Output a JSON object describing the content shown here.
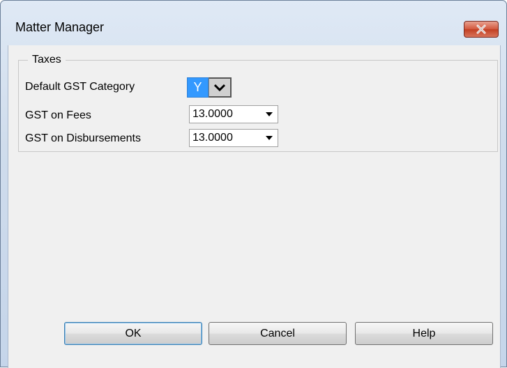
{
  "window": {
    "title": "Matter Manager"
  },
  "taxes": {
    "group_label": "Taxes",
    "default_gst_category_label": "Default GST Category",
    "default_gst_category_value": "Y",
    "gst_on_fees_label": "GST on Fees",
    "gst_on_fees_value": "13.0000",
    "gst_on_disbursements_label": "GST on Disbursements",
    "gst_on_disbursements_value": "13.0000"
  },
  "buttons": {
    "ok": "OK",
    "cancel": "Cancel",
    "help": "Help"
  },
  "icons": {
    "close": "close-icon",
    "dropdown": "chevron-down-icon",
    "combo_arrow": "triangle-down-icon"
  },
  "colors": {
    "selection": "#3399ff",
    "close_button": "#c23f22",
    "client_background": "#f0f0f0"
  }
}
